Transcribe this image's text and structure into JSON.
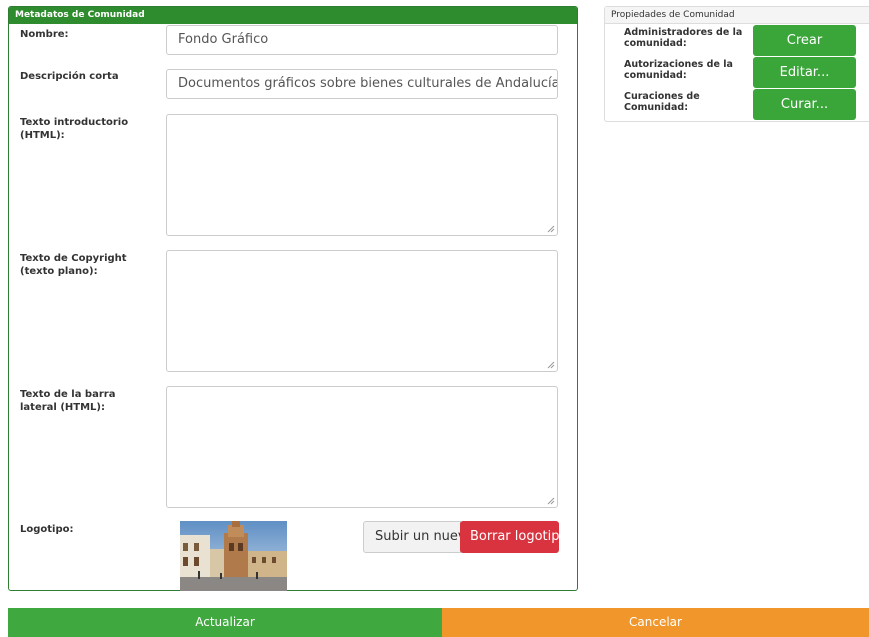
{
  "metadata_panel": {
    "title": "Metadatos de Comunidad",
    "name_label": "Nombre:",
    "name_value": "Fondo Gráfico",
    "short_desc_label": "Descripción corta",
    "short_desc_value": "Documentos gráficos sobre bienes culturales de Andalucía",
    "intro_text_label": "Texto introductorio (HTML):",
    "copyright_label": "Texto de Copyright (texto plano):",
    "sidebar_label": "Texto de la barra lateral (HTML):",
    "logo_label": "Logotipo:",
    "upload_logo_button": "Subir un nuevo logotipo",
    "delete_logo_button": "Borrar logotipo"
  },
  "properties_panel": {
    "title": "Propiedades de Comunidad",
    "admins_label": "Administradores de la comunidad:",
    "admins_button": "Crear",
    "authorizations_label": "Autorizaciones de la comunidad:",
    "authorizations_button": "Editar...",
    "curations_label": "Curaciones de Comunidad:",
    "curations_button": "Curar..."
  },
  "actions": {
    "update": "Actualizar",
    "cancel": "Cancelar"
  }
}
